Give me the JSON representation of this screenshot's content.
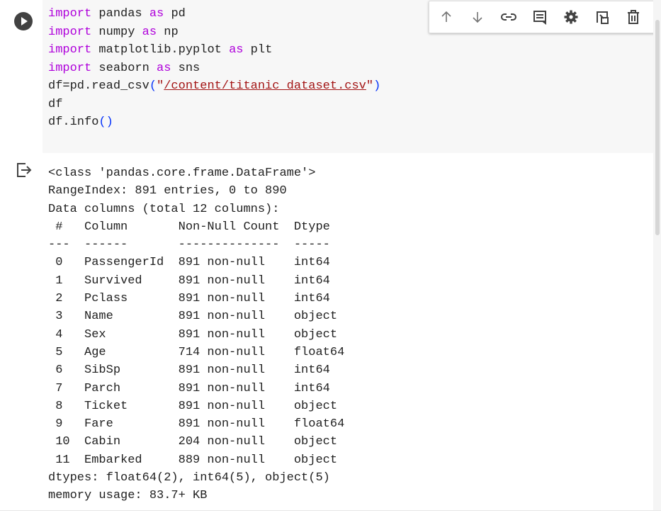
{
  "code_cell": {
    "lines": [
      [
        {
          "t": "import",
          "c": "kw"
        },
        {
          "t": " pandas "
        },
        {
          "t": "as",
          "c": "kw"
        },
        {
          "t": " pd"
        }
      ],
      [
        {
          "t": "import",
          "c": "kw"
        },
        {
          "t": " numpy "
        },
        {
          "t": "as",
          "c": "kw"
        },
        {
          "t": " np"
        }
      ],
      [
        {
          "t": "import",
          "c": "kw"
        },
        {
          "t": " matplotlib.pyplot "
        },
        {
          "t": "as",
          "c": "kw"
        },
        {
          "t": " plt"
        }
      ],
      [
        {
          "t": "import",
          "c": "kw"
        },
        {
          "t": " seaborn "
        },
        {
          "t": "as",
          "c": "kw"
        },
        {
          "t": " sns"
        }
      ],
      [
        {
          "t": "df=pd.read_csv"
        },
        {
          "t": "(",
          "c": "paren"
        },
        {
          "t": "\"",
          "c": "str"
        },
        {
          "t": "/content/titanic_dataset.csv",
          "c": "str-link"
        },
        {
          "t": "\"",
          "c": "str"
        },
        {
          "t": ")",
          "c": "paren"
        }
      ],
      [
        {
          "t": "df"
        }
      ],
      [
        {
          "t": "df.info"
        },
        {
          "t": "()",
          "c": "paren"
        }
      ]
    ]
  },
  "toolbar": {
    "icons": [
      "arrow-up-icon",
      "arrow-down-icon",
      "link-icon",
      "comment-icon",
      "gear-icon",
      "mirror-cell-icon",
      "trash-icon"
    ]
  },
  "output": {
    "icon": "output-redirect-icon",
    "lines": [
      "<class 'pandas.core.frame.DataFrame'>",
      "RangeIndex: 891 entries, 0 to 890",
      "Data columns (total 12 columns):",
      " #   Column       Non-Null Count  Dtype  ",
      "---  ------       --------------  -----  ",
      " 0   PassengerId  891 non-null    int64  ",
      " 1   Survived     891 non-null    int64  ",
      " 2   Pclass       891 non-null    int64  ",
      " 3   Name         891 non-null    object ",
      " 4   Sex          891 non-null    object ",
      " 5   Age          714 non-null    float64",
      " 6   SibSp        891 non-null    int64  ",
      " 7   Parch        891 non-null    int64  ",
      " 8   Ticket       891 non-null    object ",
      " 9   Fare         891 non-null    float64",
      " 10  Cabin        204 non-null    object ",
      " 11  Embarked     889 non-null    object ",
      "dtypes: float64(2), int64(5), object(5)",
      "memory usage: 83.7+ KB"
    ]
  }
}
